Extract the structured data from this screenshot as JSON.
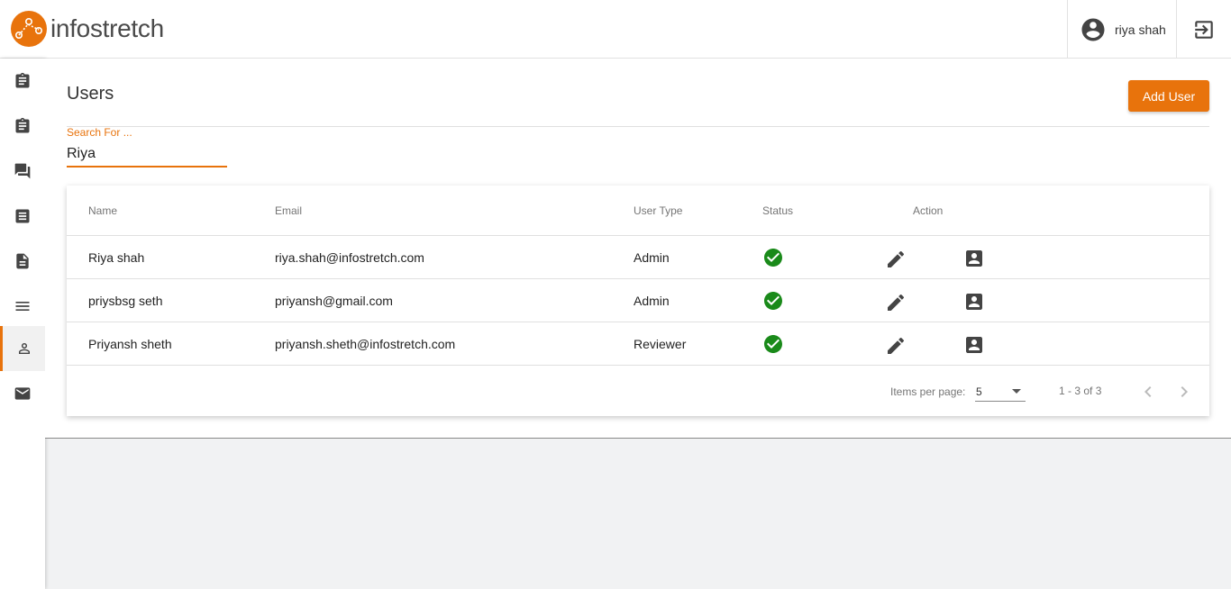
{
  "brand": {
    "name": "infostretch",
    "color": "#e8730c"
  },
  "header": {
    "username": "riya shah"
  },
  "page": {
    "title": "Users",
    "add_button": "Add User"
  },
  "search": {
    "label": "Search For ...",
    "value": "Riya"
  },
  "table": {
    "columns": [
      "Name",
      "Email",
      "User Type",
      "Status",
      "Action"
    ],
    "rows": [
      {
        "name": "Riya shah",
        "email": "riya.shah@infostretch.com",
        "type": "Admin",
        "status": "active"
      },
      {
        "name": "priysbsg seth",
        "email": "priyansh@gmail.com",
        "type": "Admin",
        "status": "active"
      },
      {
        "name": "Priyansh sheth",
        "email": "priyansh.sheth@infostretch.com",
        "type": "Reviewer",
        "status": "active"
      }
    ]
  },
  "paginator": {
    "label": "Items per page:",
    "per_page": "5",
    "range": "1 - 3 of 3"
  },
  "sidebar": {
    "items": [
      {
        "icon": "clipboard-icon"
      },
      {
        "icon": "clipboard-icon"
      },
      {
        "icon": "chat-icon"
      },
      {
        "icon": "document-list-icon"
      },
      {
        "icon": "file-icon"
      },
      {
        "icon": "menu-icon"
      },
      {
        "icon": "person-icon",
        "active": true
      },
      {
        "icon": "mail-icon"
      }
    ]
  }
}
